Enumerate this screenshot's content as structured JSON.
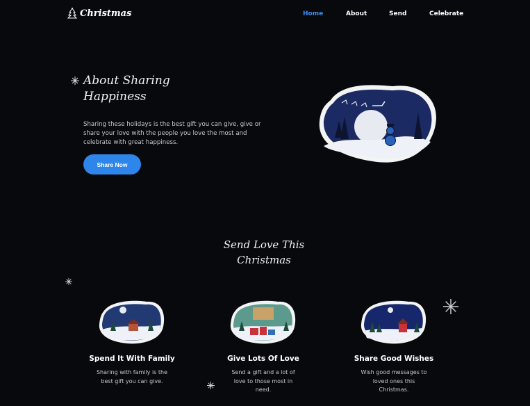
{
  "nav": {
    "logo_text": "Christmas",
    "links": [
      {
        "label": "Home",
        "active": true
      },
      {
        "label": "About",
        "active": false
      },
      {
        "label": "Send",
        "active": false
      },
      {
        "label": "Celebrate",
        "active": false
      }
    ]
  },
  "hero": {
    "title_line1": "About Sharing",
    "title_line2": "Happiness",
    "text": "Sharing these holidays is the best gift you can give, give or share your love with the people you love the most and celebrate with great happiness.",
    "button_label": "Share Now"
  },
  "section": {
    "title_line1": "Send Love This",
    "title_line2": "Christmas"
  },
  "cards": [
    {
      "title": "Spend It With Family",
      "text": "Sharing with family is the best gift you can give."
    },
    {
      "title": "Give Lots Of Love",
      "text": "Send a gift and a lot of love to those most in need."
    },
    {
      "title": "Share Good Wishes",
      "text": "Wish good messages to loved ones this Christmas."
    }
  ],
  "colors": {
    "accent": "#2f86ea",
    "active_link": "#3d8ef5",
    "background": "#07090d"
  },
  "icons": [
    "christmas-tree-icon",
    "snowflake-icon"
  ]
}
